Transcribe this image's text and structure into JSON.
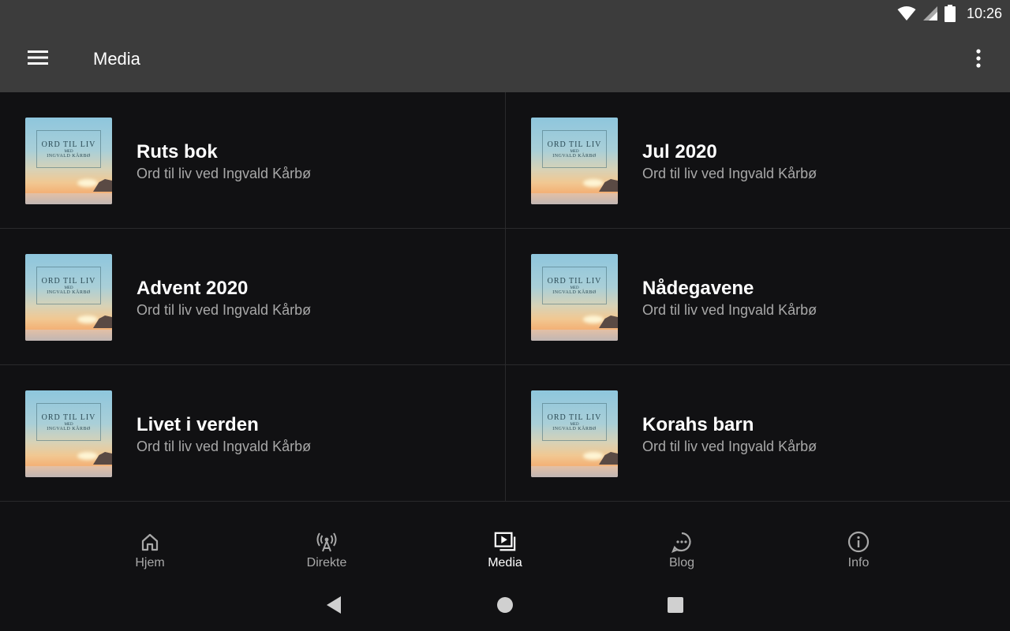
{
  "status_bar": {
    "time": "10:26",
    "icons": [
      "wifi-icon",
      "signal-icon",
      "battery-icon"
    ]
  },
  "app_bar": {
    "title": "Media",
    "menu_icon": "hamburger-menu-icon",
    "more_icon": "more-vert-icon"
  },
  "thumbnail": {
    "line1": "ORD TIL LIV",
    "line2": "MED",
    "line3": "INGVALD KÅRBØ"
  },
  "media_items": [
    {
      "title": "Ruts bok",
      "subtitle": "Ord til liv ved Ingvald Kårbø"
    },
    {
      "title": "Jul 2020",
      "subtitle": "Ord til liv ved Ingvald Kårbø"
    },
    {
      "title": "Advent 2020",
      "subtitle": "Ord til liv ved Ingvald Kårbø"
    },
    {
      "title": "Nådegavene",
      "subtitle": "Ord til liv ved Ingvald Kårbø"
    },
    {
      "title": "Livet i verden",
      "subtitle": "Ord til liv ved Ingvald Kårbø"
    },
    {
      "title": "Korahs barn",
      "subtitle": "Ord til liv ved Ingvald Kårbø"
    }
  ],
  "bottom_nav": [
    {
      "label": "Hjem",
      "icon": "home-icon",
      "active": false
    },
    {
      "label": "Direkte",
      "icon": "broadcast-icon",
      "active": false
    },
    {
      "label": "Media",
      "icon": "video-library-icon",
      "active": true
    },
    {
      "label": "Blog",
      "icon": "chat-bubble-icon",
      "active": false
    },
    {
      "label": "Info",
      "icon": "info-icon",
      "active": false
    }
  ],
  "system_nav": [
    "back-icon",
    "home-circle-icon",
    "recents-icon"
  ],
  "colors": {
    "app_bar": "#3c3c3c",
    "background": "#111113",
    "divider": "#2a2a2c",
    "subtitle": "#a8a8a8",
    "nav_inactive": "#a8a8a8",
    "nav_active": "#ffffff"
  }
}
